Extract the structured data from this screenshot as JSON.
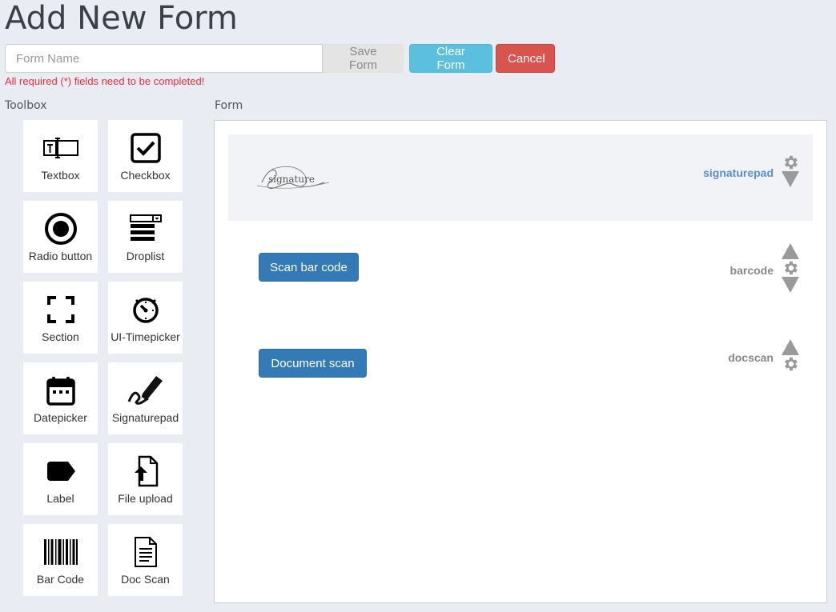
{
  "page": {
    "title": "Add New Form"
  },
  "header": {
    "form_name_placeholder": "Form Name",
    "save_label": "Save Form",
    "clear_label": "Clear Form",
    "cancel_label": "Cancel",
    "error_message": "All required (*) fields need to be completed!"
  },
  "toolbox": {
    "label": "Toolbox",
    "items": [
      {
        "label": "Textbox",
        "icon": "textbox-icon"
      },
      {
        "label": "Checkbox",
        "icon": "checkbox-icon"
      },
      {
        "label": "Radio button",
        "icon": "radio-icon"
      },
      {
        "label": "Droplist",
        "icon": "droplist-icon"
      },
      {
        "label": "Section",
        "icon": "section-icon"
      },
      {
        "label": "UI-Timepicker",
        "icon": "clock-icon"
      },
      {
        "label": "Datepicker",
        "icon": "calendar-icon"
      },
      {
        "label": "Signaturepad",
        "icon": "pen-signature-icon"
      },
      {
        "label": "Label",
        "icon": "tag-icon"
      },
      {
        "label": "File upload",
        "icon": "file-upload-icon"
      },
      {
        "label": "Bar Code",
        "icon": "barcode-icon"
      },
      {
        "label": "Doc Scan",
        "icon": "document-icon"
      }
    ]
  },
  "form": {
    "label": "Form",
    "fields": [
      {
        "name": "signaturepad",
        "image_text": "signature"
      },
      {
        "name": "barcode",
        "button_label": "Scan bar code"
      },
      {
        "name": "docscan",
        "button_label": "Document scan"
      }
    ]
  },
  "colors": {
    "background": "#e9ecf3",
    "clear": "#5bc0de",
    "cancel": "#d9534f",
    "primary": "#337ab7",
    "error": "#e8303a",
    "active_field": "#5b8fd0"
  }
}
